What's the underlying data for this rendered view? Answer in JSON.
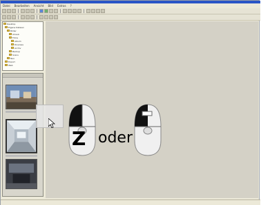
{
  "menu": [
    "Datei",
    "Bearbeiten",
    "Ansicht",
    "Bild",
    "Extras",
    "?"
  ],
  "tree_items": [
    "Desktop",
    "Eigene Dateien",
    "Bilder",
    "Urlaub",
    "Fotos",
    "Album",
    "Diverses",
    "Archiv",
    "Backup",
    "Scans",
    "Neu",
    "Export",
    "Web"
  ],
  "thumbs_header": "",
  "overlay": {
    "key_label": "Z",
    "or_label": "oder"
  },
  "colors": {
    "workspace": "#d4d1c6",
    "title_bar": "#2a55c6",
    "folder": "#e8c64a"
  }
}
